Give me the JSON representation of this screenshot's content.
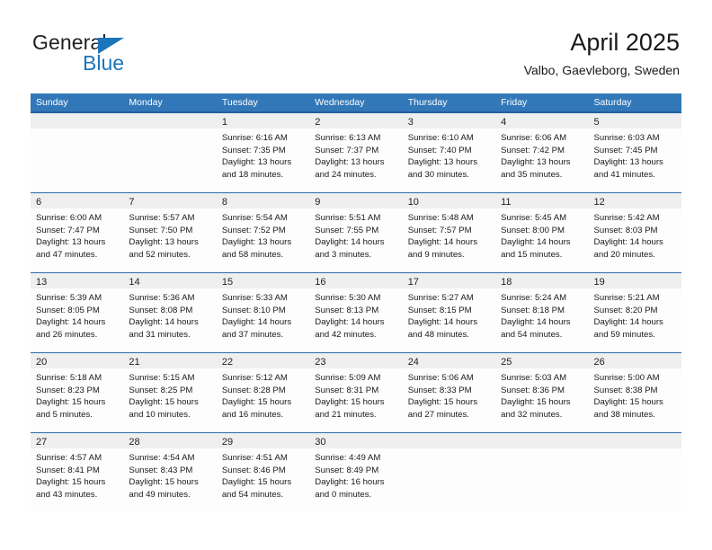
{
  "brand": {
    "name_part1": "General",
    "name_part2": "Blue",
    "accent_color": "#1b75bb"
  },
  "header": {
    "title": "April 2025",
    "subtitle": "Valbo, Gaevleborg, Sweden"
  },
  "theme": {
    "header_row_bg": "#3278b8",
    "day_band_bg": "#efefef",
    "row_divider": "#2b6cad"
  },
  "weekdays": [
    "Sunday",
    "Monday",
    "Tuesday",
    "Wednesday",
    "Thursday",
    "Friday",
    "Saturday"
  ],
  "weeks": [
    [
      {
        "day": "",
        "sunrise": "",
        "sunset": "",
        "daylight_line1": "",
        "daylight_line2": ""
      },
      {
        "day": "",
        "sunrise": "",
        "sunset": "",
        "daylight_line1": "",
        "daylight_line2": ""
      },
      {
        "day": "1",
        "sunrise": "Sunrise: 6:16 AM",
        "sunset": "Sunset: 7:35 PM",
        "daylight_line1": "Daylight: 13 hours",
        "daylight_line2": "and 18 minutes."
      },
      {
        "day": "2",
        "sunrise": "Sunrise: 6:13 AM",
        "sunset": "Sunset: 7:37 PM",
        "daylight_line1": "Daylight: 13 hours",
        "daylight_line2": "and 24 minutes."
      },
      {
        "day": "3",
        "sunrise": "Sunrise: 6:10 AM",
        "sunset": "Sunset: 7:40 PM",
        "daylight_line1": "Daylight: 13 hours",
        "daylight_line2": "and 30 minutes."
      },
      {
        "day": "4",
        "sunrise": "Sunrise: 6:06 AM",
        "sunset": "Sunset: 7:42 PM",
        "daylight_line1": "Daylight: 13 hours",
        "daylight_line2": "and 35 minutes."
      },
      {
        "day": "5",
        "sunrise": "Sunrise: 6:03 AM",
        "sunset": "Sunset: 7:45 PM",
        "daylight_line1": "Daylight: 13 hours",
        "daylight_line2": "and 41 minutes."
      }
    ],
    [
      {
        "day": "6",
        "sunrise": "Sunrise: 6:00 AM",
        "sunset": "Sunset: 7:47 PM",
        "daylight_line1": "Daylight: 13 hours",
        "daylight_line2": "and 47 minutes."
      },
      {
        "day": "7",
        "sunrise": "Sunrise: 5:57 AM",
        "sunset": "Sunset: 7:50 PM",
        "daylight_line1": "Daylight: 13 hours",
        "daylight_line2": "and 52 minutes."
      },
      {
        "day": "8",
        "sunrise": "Sunrise: 5:54 AM",
        "sunset": "Sunset: 7:52 PM",
        "daylight_line1": "Daylight: 13 hours",
        "daylight_line2": "and 58 minutes."
      },
      {
        "day": "9",
        "sunrise": "Sunrise: 5:51 AM",
        "sunset": "Sunset: 7:55 PM",
        "daylight_line1": "Daylight: 14 hours",
        "daylight_line2": "and 3 minutes."
      },
      {
        "day": "10",
        "sunrise": "Sunrise: 5:48 AM",
        "sunset": "Sunset: 7:57 PM",
        "daylight_line1": "Daylight: 14 hours",
        "daylight_line2": "and 9 minutes."
      },
      {
        "day": "11",
        "sunrise": "Sunrise: 5:45 AM",
        "sunset": "Sunset: 8:00 PM",
        "daylight_line1": "Daylight: 14 hours",
        "daylight_line2": "and 15 minutes."
      },
      {
        "day": "12",
        "sunrise": "Sunrise: 5:42 AM",
        "sunset": "Sunset: 8:03 PM",
        "daylight_line1": "Daylight: 14 hours",
        "daylight_line2": "and 20 minutes."
      }
    ],
    [
      {
        "day": "13",
        "sunrise": "Sunrise: 5:39 AM",
        "sunset": "Sunset: 8:05 PM",
        "daylight_line1": "Daylight: 14 hours",
        "daylight_line2": "and 26 minutes."
      },
      {
        "day": "14",
        "sunrise": "Sunrise: 5:36 AM",
        "sunset": "Sunset: 8:08 PM",
        "daylight_line1": "Daylight: 14 hours",
        "daylight_line2": "and 31 minutes."
      },
      {
        "day": "15",
        "sunrise": "Sunrise: 5:33 AM",
        "sunset": "Sunset: 8:10 PM",
        "daylight_line1": "Daylight: 14 hours",
        "daylight_line2": "and 37 minutes."
      },
      {
        "day": "16",
        "sunrise": "Sunrise: 5:30 AM",
        "sunset": "Sunset: 8:13 PM",
        "daylight_line1": "Daylight: 14 hours",
        "daylight_line2": "and 42 minutes."
      },
      {
        "day": "17",
        "sunrise": "Sunrise: 5:27 AM",
        "sunset": "Sunset: 8:15 PM",
        "daylight_line1": "Daylight: 14 hours",
        "daylight_line2": "and 48 minutes."
      },
      {
        "day": "18",
        "sunrise": "Sunrise: 5:24 AM",
        "sunset": "Sunset: 8:18 PM",
        "daylight_line1": "Daylight: 14 hours",
        "daylight_line2": "and 54 minutes."
      },
      {
        "day": "19",
        "sunrise": "Sunrise: 5:21 AM",
        "sunset": "Sunset: 8:20 PM",
        "daylight_line1": "Daylight: 14 hours",
        "daylight_line2": "and 59 minutes."
      }
    ],
    [
      {
        "day": "20",
        "sunrise": "Sunrise: 5:18 AM",
        "sunset": "Sunset: 8:23 PM",
        "daylight_line1": "Daylight: 15 hours",
        "daylight_line2": "and 5 minutes."
      },
      {
        "day": "21",
        "sunrise": "Sunrise: 5:15 AM",
        "sunset": "Sunset: 8:25 PM",
        "daylight_line1": "Daylight: 15 hours",
        "daylight_line2": "and 10 minutes."
      },
      {
        "day": "22",
        "sunrise": "Sunrise: 5:12 AM",
        "sunset": "Sunset: 8:28 PM",
        "daylight_line1": "Daylight: 15 hours",
        "daylight_line2": "and 16 minutes."
      },
      {
        "day": "23",
        "sunrise": "Sunrise: 5:09 AM",
        "sunset": "Sunset: 8:31 PM",
        "daylight_line1": "Daylight: 15 hours",
        "daylight_line2": "and 21 minutes."
      },
      {
        "day": "24",
        "sunrise": "Sunrise: 5:06 AM",
        "sunset": "Sunset: 8:33 PM",
        "daylight_line1": "Daylight: 15 hours",
        "daylight_line2": "and 27 minutes."
      },
      {
        "day": "25",
        "sunrise": "Sunrise: 5:03 AM",
        "sunset": "Sunset: 8:36 PM",
        "daylight_line1": "Daylight: 15 hours",
        "daylight_line2": "and 32 minutes."
      },
      {
        "day": "26",
        "sunrise": "Sunrise: 5:00 AM",
        "sunset": "Sunset: 8:38 PM",
        "daylight_line1": "Daylight: 15 hours",
        "daylight_line2": "and 38 minutes."
      }
    ],
    [
      {
        "day": "27",
        "sunrise": "Sunrise: 4:57 AM",
        "sunset": "Sunset: 8:41 PM",
        "daylight_line1": "Daylight: 15 hours",
        "daylight_line2": "and 43 minutes."
      },
      {
        "day": "28",
        "sunrise": "Sunrise: 4:54 AM",
        "sunset": "Sunset: 8:43 PM",
        "daylight_line1": "Daylight: 15 hours",
        "daylight_line2": "and 49 minutes."
      },
      {
        "day": "29",
        "sunrise": "Sunrise: 4:51 AM",
        "sunset": "Sunset: 8:46 PM",
        "daylight_line1": "Daylight: 15 hours",
        "daylight_line2": "and 54 minutes."
      },
      {
        "day": "30",
        "sunrise": "Sunrise: 4:49 AM",
        "sunset": "Sunset: 8:49 PM",
        "daylight_line1": "Daylight: 16 hours",
        "daylight_line2": "and 0 minutes."
      },
      {
        "day": "",
        "sunrise": "",
        "sunset": "",
        "daylight_line1": "",
        "daylight_line2": ""
      },
      {
        "day": "",
        "sunrise": "",
        "sunset": "",
        "daylight_line1": "",
        "daylight_line2": ""
      },
      {
        "day": "",
        "sunrise": "",
        "sunset": "",
        "daylight_line1": "",
        "daylight_line2": ""
      }
    ]
  ]
}
